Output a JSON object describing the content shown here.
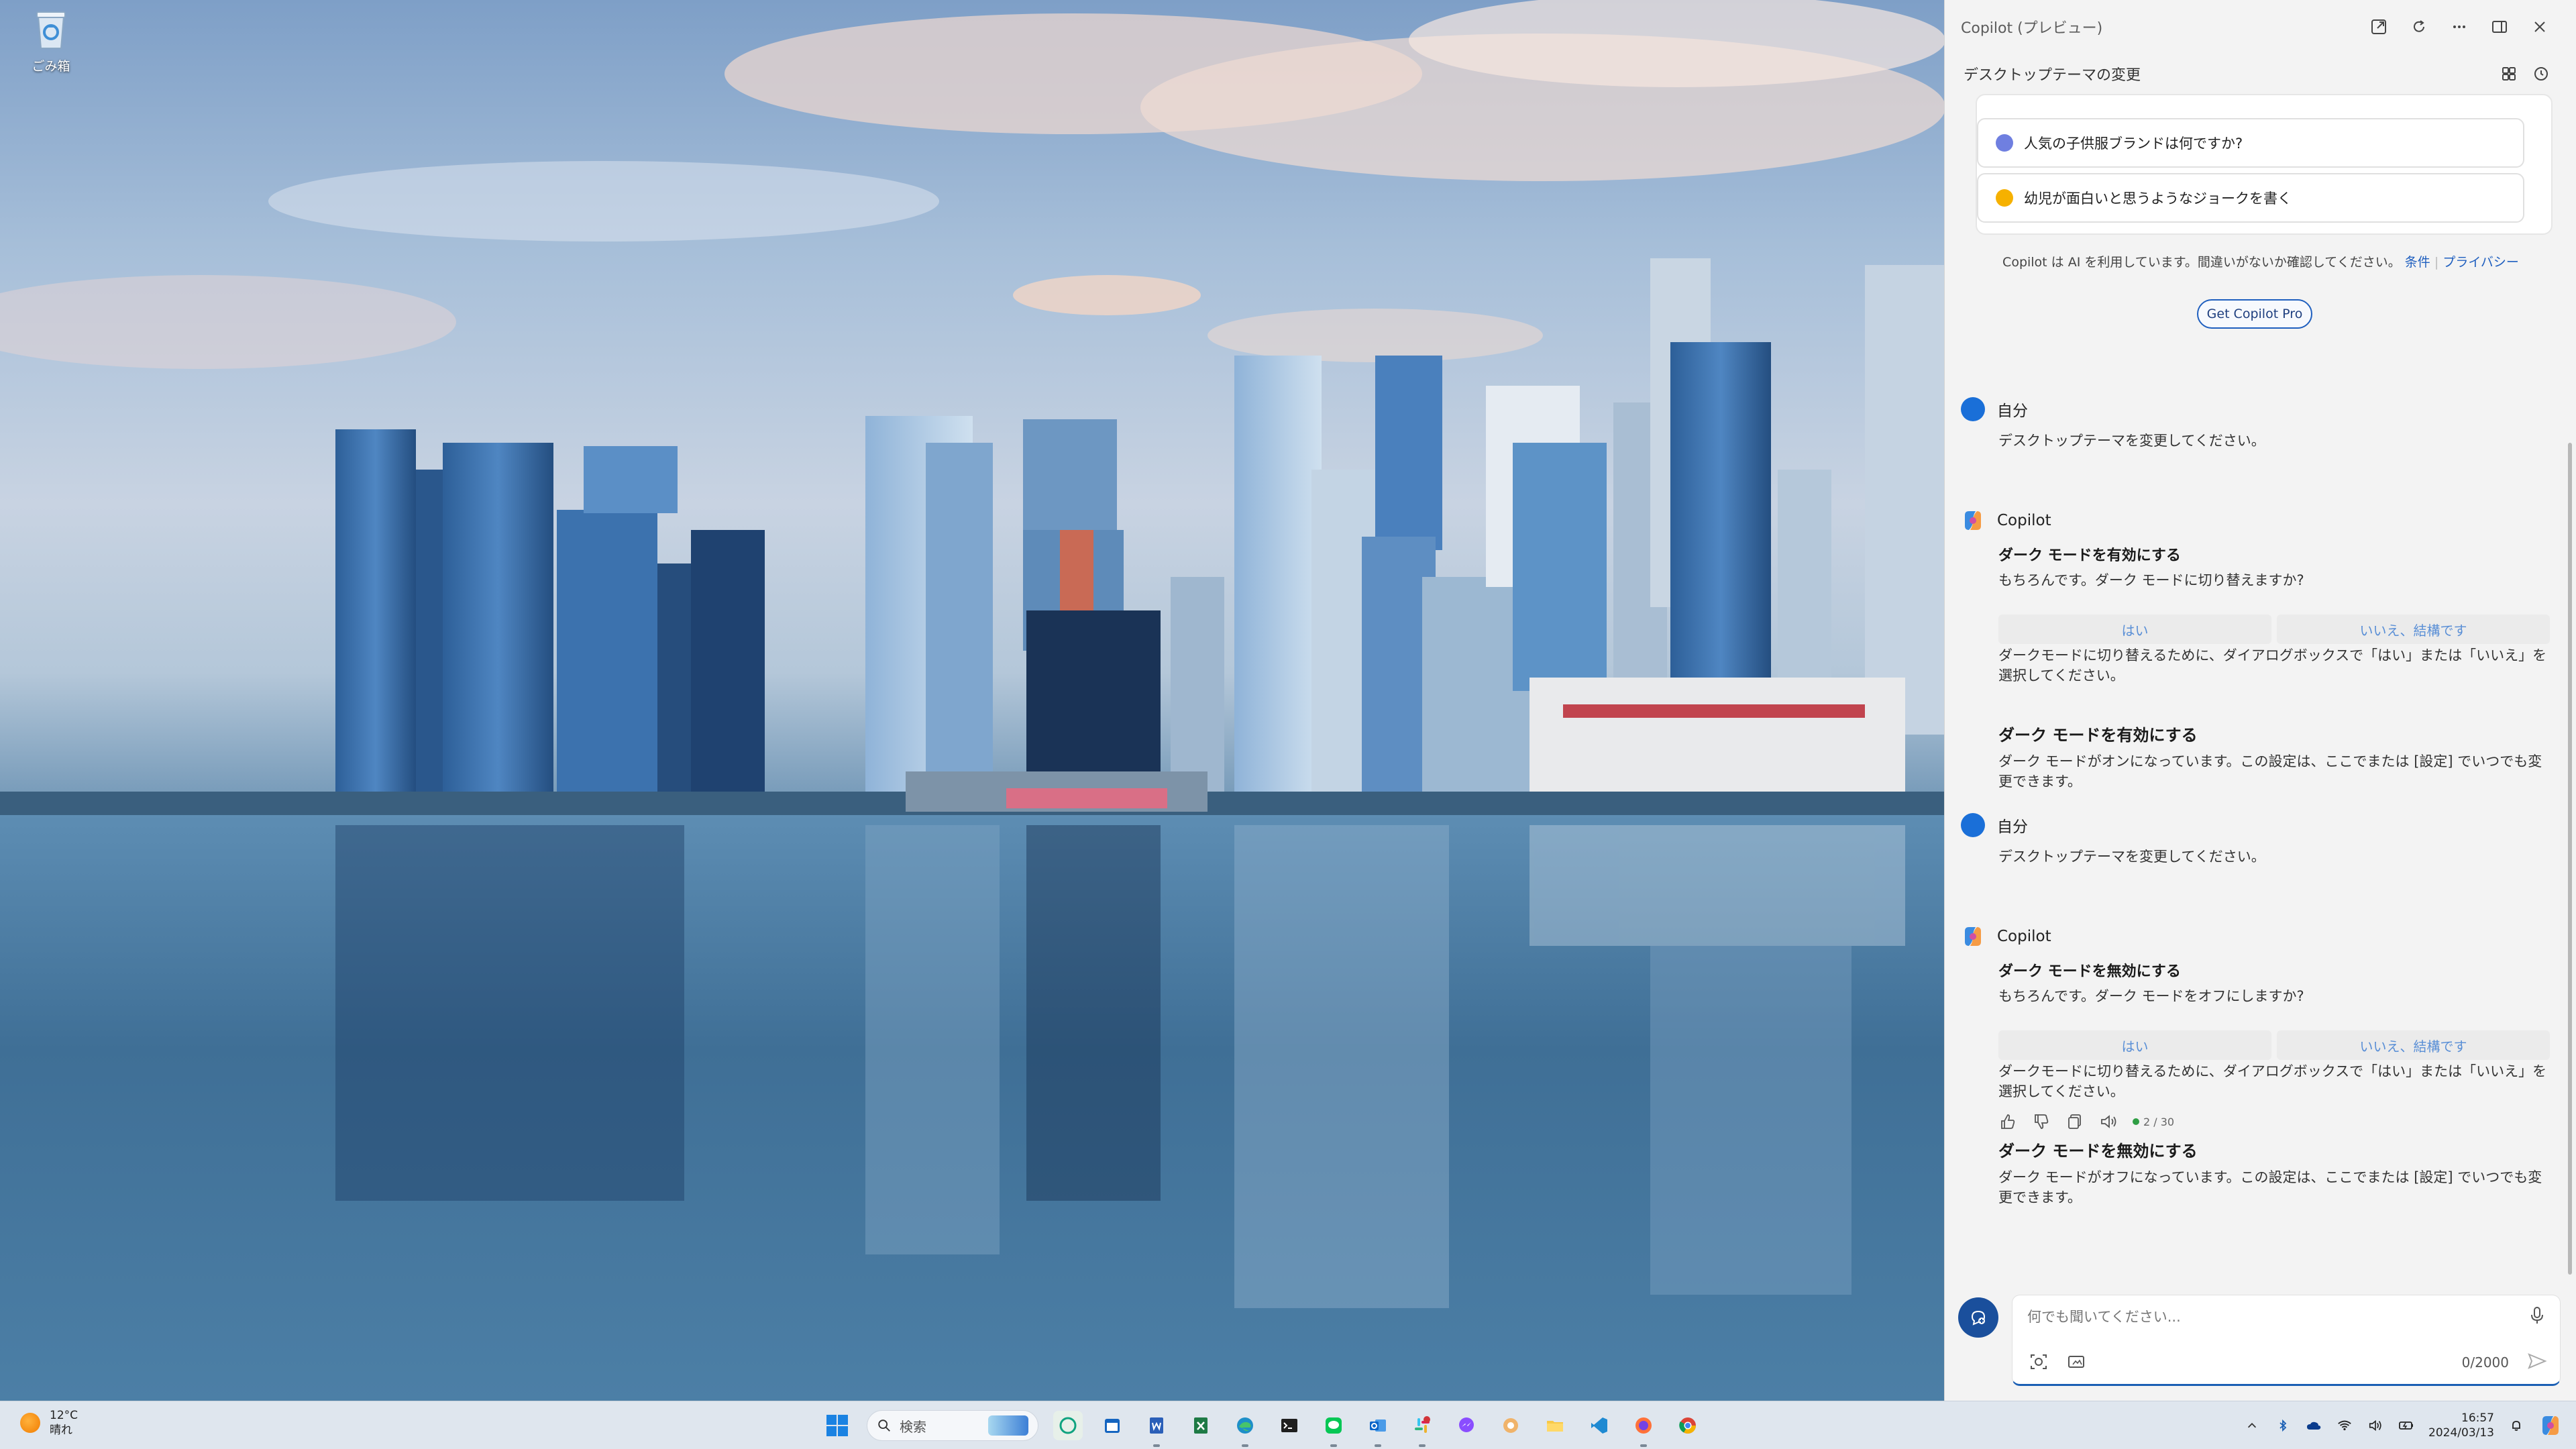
{
  "desktop": {
    "icons": [
      {
        "label": "ごみ箱",
        "icon": "recycle-bin-icon"
      }
    ]
  },
  "copilot": {
    "window_title": "Copilot (プレビュー)",
    "subtitle": "デスクトップテーマの変更",
    "suggestions": [
      {
        "text": "人気の子供服ブランドは何ですか?",
        "icon": "tag-icon",
        "color": "#5b6fd6"
      },
      {
        "text": "幼児が面白いと思うようなジョークを書く",
        "icon": "laughing-emoji-icon",
        "color": "#f6b100"
      }
    ],
    "disclaimer": {
      "text": "Copilot は AI を利用しています。間違いがないか確認してください。",
      "terms": "条件",
      "privacy": "プライバシー"
    },
    "pro_button": "Get Copilot Pro",
    "messages": [
      {
        "author": "自分",
        "text": "デスクトップテーマを変更してください。"
      },
      {
        "author": "Copilot",
        "heading": "ダーク モードを有効にする",
        "question": "もちろんです。ダーク モードに切り替えますか?",
        "yes": "はい",
        "no": "いいえ、結構です",
        "instruction": "ダークモードに切り替えるために、ダイアログボックスで「はい」または「いいえ」を選択してください。",
        "result_heading": "ダーク モードを有効にする",
        "result_text": "ダーク モードがオンになっています。この設定は、ここでまたは [設定] でいつでも変更できます。"
      },
      {
        "author": "自分",
        "text": "デスクトップテーマを変更してください。"
      },
      {
        "author": "Copilot",
        "heading": "ダーク モードを無効にする",
        "question": "もちろんです。ダーク モードをオフにしますか?",
        "yes": "はい",
        "no": "いいえ、結構です",
        "instruction": "ダークモードに切り替えるために、ダイアログボックスで「はい」または「いいえ」を選択してください。",
        "counter": "2 / 30",
        "result_heading": "ダーク モードを無効にする",
        "result_text": "ダーク モードがオフになっています。この設定は、ここでまたは [設定] でいつでも変更できます。"
      }
    ],
    "input": {
      "placeholder": "何でも聞いてください...",
      "char_count": "0/2000"
    },
    "accent_color": "#1a5fb4"
  },
  "taskbar": {
    "weather": {
      "temp": "12°C",
      "condition": "晴れ"
    },
    "search_placeholder": "検索",
    "apps": [
      "chatgpt-icon",
      "calendar-icon",
      "word-icon",
      "excel-icon",
      "edge-icon",
      "terminal-icon",
      "line-icon",
      "outlook-icon",
      "slack-icon",
      "messenger-icon",
      "photos-icon",
      "file-explorer-icon",
      "vscode-icon",
      "firefox-icon",
      "chrome-icon"
    ],
    "clock": {
      "time": "16:57",
      "date": "2024/03/13"
    }
  }
}
